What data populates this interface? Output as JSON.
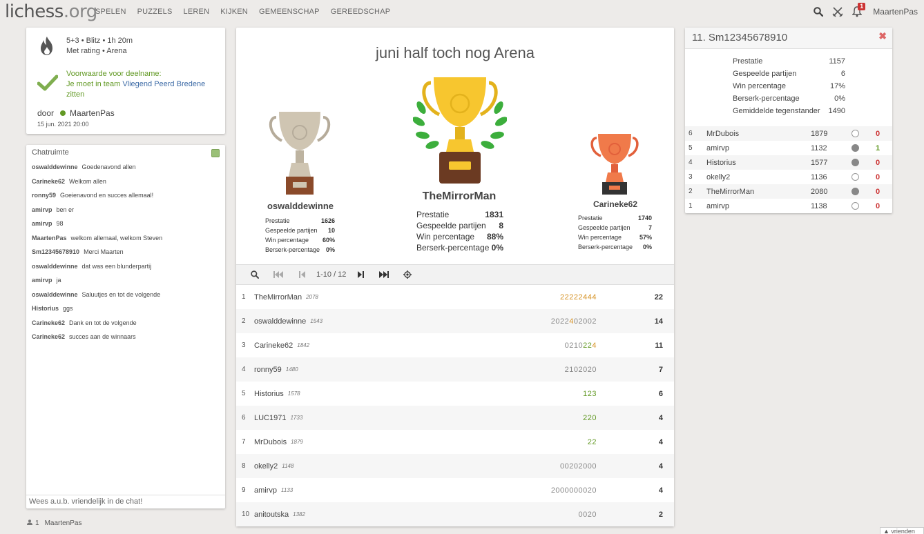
{
  "header": {
    "logo_main": "lichess",
    "logo_tld": ".org",
    "nav": [
      "SPELEN",
      "PUZZELS",
      "LEREN",
      "KIJKEN",
      "GEMEENSCHAP",
      "GEREEDSCHAP"
    ],
    "notification_count": "1",
    "username": "MaartenPas",
    "icons": [
      "search-icon",
      "swords-icon",
      "bell-icon"
    ]
  },
  "info": {
    "line1": "5+3 • Blitz • 1h 20m",
    "line2": "Met rating • Arena",
    "cond_title": "Voorwaarde voor deelname:",
    "cond_pre": "Je moet in team",
    "cond_team": "Vliegend Peerd Bredene",
    "cond_post": "zitten",
    "by_label": "door",
    "by_user": "MaartenPas",
    "date": "15 jun. 2021 20:00"
  },
  "chat": {
    "title": "Chatruimte",
    "lines": [
      {
        "user": "oswalddewinne",
        "text": "Goedenavond allen"
      },
      {
        "user": "Carineke62",
        "text": "Welkom allen"
      },
      {
        "user": "ronny59",
        "text": "Goeienavond en succes allemaal!"
      },
      {
        "user": "amirvp",
        "text": "ben er"
      },
      {
        "user": "amirvp",
        "text": "98"
      },
      {
        "user": "MaartenPas",
        "text": "welkom allemaal, welkom Steven"
      },
      {
        "user": "Sm12345678910",
        "text": "Merci Maarten"
      },
      {
        "user": "oswalddewinne",
        "text": "dat was een blunderpartij"
      },
      {
        "user": "amirvp",
        "text": "ja"
      },
      {
        "user": "oswalddewinne",
        "text": "Saluutjes en tot de volgende"
      },
      {
        "user": "Historius",
        "text": "ggs"
      },
      {
        "user": "Carineke62",
        "text": "Dank en tot de volgende"
      },
      {
        "user": "Carineke62",
        "text": "succes aan de winnaars"
      }
    ],
    "input_placeholder": "Wees a.u.b. vriendelijk in de chat!",
    "spectator_count": "1",
    "spectator_name": "MaartenPas"
  },
  "tournament": {
    "title": "juni half toch nog Arena",
    "podium": [
      {
        "place": 1,
        "name": "TheMirrorMan",
        "stats": [
          [
            "Prestatie",
            "1831"
          ],
          [
            "Gespeelde partijen",
            "8"
          ],
          [
            "Win percentage",
            "88%"
          ],
          [
            "Berserk-percentage",
            "0%"
          ]
        ]
      },
      {
        "place": 2,
        "name": "oswalddewinne",
        "stats": [
          [
            "Prestatie",
            "1626"
          ],
          [
            "Gespeelde partijen",
            "10"
          ],
          [
            "Win percentage",
            "60%"
          ],
          [
            "Berserk-percentage",
            "0%"
          ]
        ]
      },
      {
        "place": 3,
        "name": "Carineke62",
        "stats": [
          [
            "Prestatie",
            "1740"
          ],
          [
            "Gespeelde partijen",
            "7"
          ],
          [
            "Win percentage",
            "57%"
          ],
          [
            "Berserk-percentage",
            "0%"
          ]
        ]
      }
    ],
    "pager_label": "1-10 / 12",
    "standings": [
      {
        "rank": "1",
        "name": "TheMirrorMan",
        "rating": "2078",
        "sheet": [
          [
            "22222",
            "f"
          ],
          [
            "444",
            "fire"
          ]
        ],
        "score": "22"
      },
      {
        "rank": "2",
        "name": "oswalddewinne",
        "rating": "1543",
        "sheet": [
          [
            "2022",
            "d"
          ],
          [
            "4",
            "f"
          ],
          [
            "02002",
            "d"
          ]
        ],
        "score": "14"
      },
      {
        "rank": "3",
        "name": "Carineke62",
        "rating": "1842",
        "sheet": [
          [
            "0210",
            "d"
          ],
          [
            "22",
            "w"
          ],
          [
            "4",
            "fire"
          ]
        ],
        "score": "11"
      },
      {
        "rank": "4",
        "name": "ronny59",
        "rating": "1480",
        "sheet": [
          [
            "2102020",
            "d"
          ]
        ],
        "score": "7"
      },
      {
        "rank": "5",
        "name": "Historius",
        "rating": "1578",
        "sheet": [
          [
            "123",
            "w"
          ]
        ],
        "score": "6"
      },
      {
        "rank": "6",
        "name": "LUC1971",
        "rating": "1733",
        "sheet": [
          [
            "220",
            "w"
          ]
        ],
        "score": "4"
      },
      {
        "rank": "7",
        "name": "MrDubois",
        "rating": "1879",
        "sheet": [
          [
            "22",
            "w"
          ]
        ],
        "score": "4"
      },
      {
        "rank": "8",
        "name": "okelly2",
        "rating": "1148",
        "sheet": [
          [
            "00202000",
            "d"
          ]
        ],
        "score": "4"
      },
      {
        "rank": "9",
        "name": "amirvp",
        "rating": "1133",
        "sheet": [
          [
            "2000000020",
            "d"
          ]
        ],
        "score": "4"
      },
      {
        "rank": "10",
        "name": "anitoutska",
        "rating": "1382",
        "sheet": [
          [
            "0020",
            "d"
          ]
        ],
        "score": "2"
      }
    ]
  },
  "player": {
    "title": "11. Sm12345678910",
    "stats": [
      [
        "Prestatie",
        "1157"
      ],
      [
        "Gespeelde partijen",
        "6"
      ],
      [
        "Win percentage",
        "17%"
      ],
      [
        "Berserk-percentage",
        "0%"
      ],
      [
        "Gemiddelde tegenstander",
        "1490"
      ]
    ],
    "games": [
      {
        "n": "6",
        "name": "MrDubois",
        "rating": "1879",
        "color": "white",
        "result": "0"
      },
      {
        "n": "5",
        "name": "amirvp",
        "rating": "1132",
        "color": "black",
        "result": "1"
      },
      {
        "n": "4",
        "name": "Historius",
        "rating": "1577",
        "color": "black",
        "result": "0"
      },
      {
        "n": "3",
        "name": "okelly2",
        "rating": "1136",
        "color": "white",
        "result": "0"
      },
      {
        "n": "2",
        "name": "TheMirrorMan",
        "rating": "2080",
        "color": "black",
        "result": "0"
      },
      {
        "n": "1",
        "name": "amirvp",
        "rating": "1138",
        "color": "white",
        "result": "0"
      }
    ]
  },
  "friends_label": "▲ vrienden o..."
}
